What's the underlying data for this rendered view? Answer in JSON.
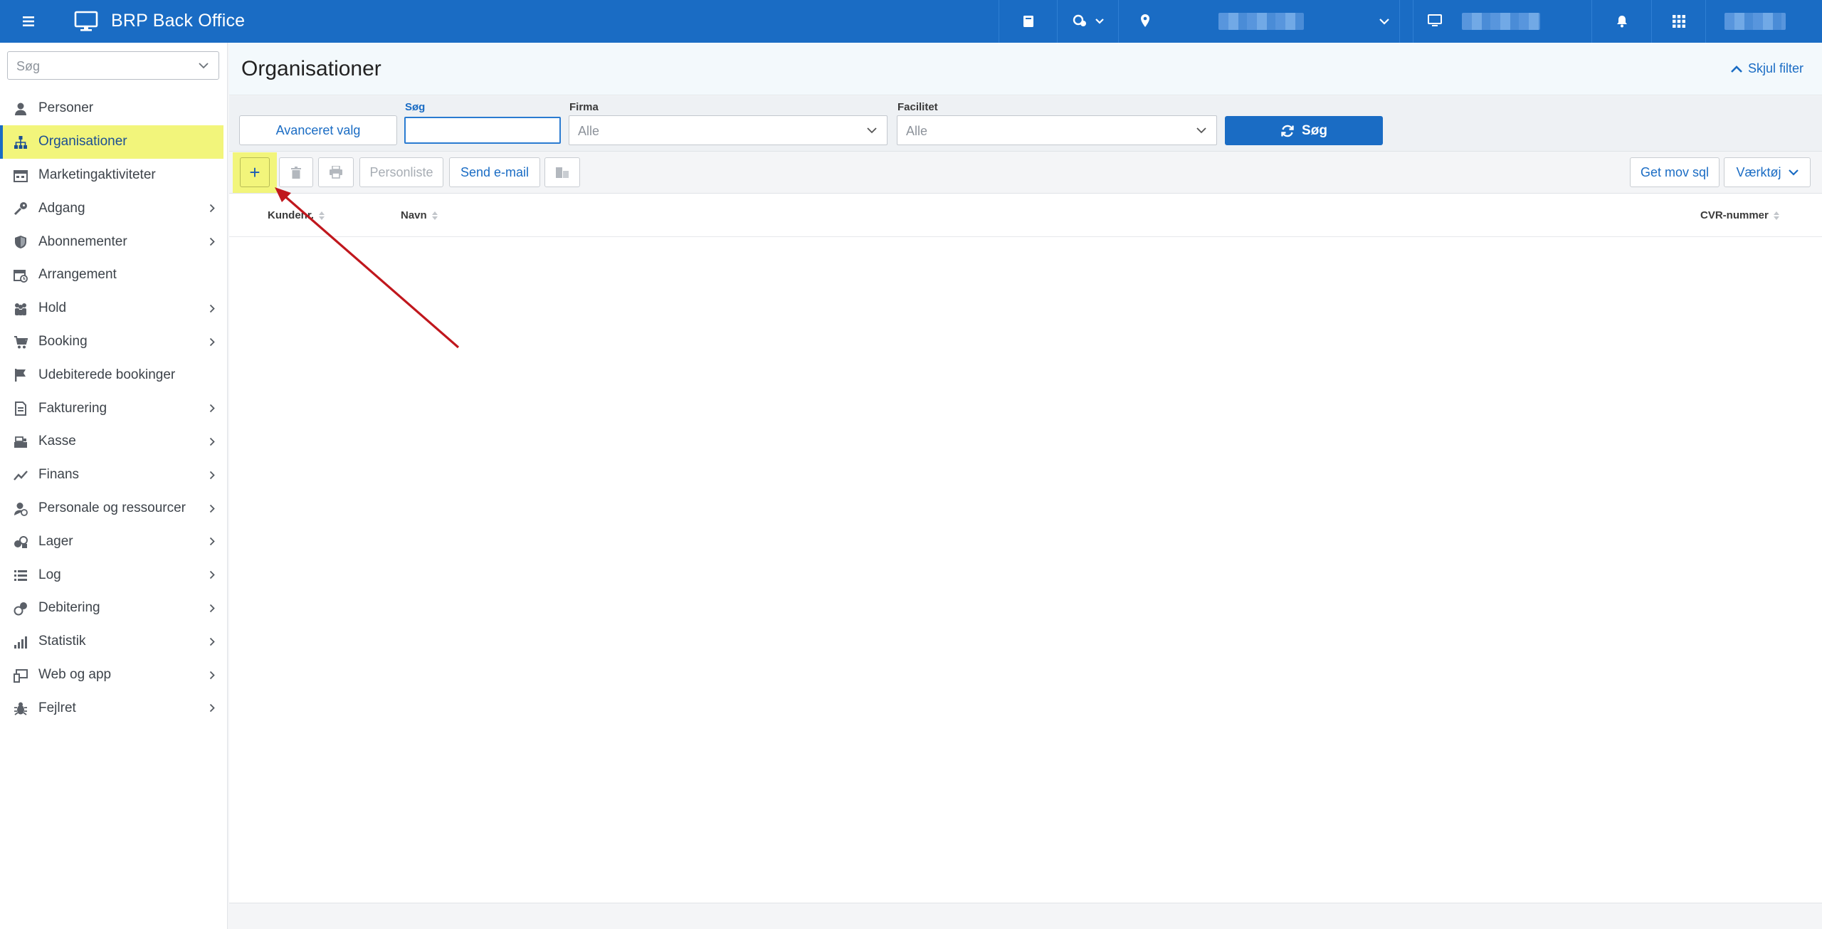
{
  "app": {
    "title": "BRP Back Office"
  },
  "topbar": {
    "icons": [
      "menu-icon",
      "monitor-icon",
      "book-icon",
      "user-location-icon",
      "location-pin-icon",
      "chevron-down-icon",
      "monitor-icon",
      "bell-icon",
      "apps-grid-icon"
    ]
  },
  "sidebar": {
    "search_placeholder": "Søg",
    "items": [
      {
        "label": "Personer",
        "icon": "person-icon",
        "arrow": false
      },
      {
        "label": "Organisationer",
        "icon": "org-chart-icon",
        "arrow": false,
        "active": true
      },
      {
        "label": "Marketingaktiviteter",
        "icon": "calendar-grid-icon",
        "arrow": false
      },
      {
        "label": "Adgang",
        "icon": "key-icon",
        "arrow": true
      },
      {
        "label": "Abonnementer",
        "icon": "shield-icon",
        "arrow": true
      },
      {
        "label": "Arrangement",
        "icon": "calendar-clock-icon",
        "arrow": false
      },
      {
        "label": "Hold",
        "icon": "group-icon",
        "arrow": true
      },
      {
        "label": "Booking",
        "icon": "cart-icon",
        "arrow": true
      },
      {
        "label": "Udebiterede bookinger",
        "icon": "flag-icon",
        "arrow": false
      },
      {
        "label": "Fakturering",
        "icon": "invoice-icon",
        "arrow": true
      },
      {
        "label": "Kasse",
        "icon": "cash-register-icon",
        "arrow": true
      },
      {
        "label": "Finans",
        "icon": "trend-line-icon",
        "arrow": true
      },
      {
        "label": "Personale og ressourcer",
        "icon": "staff-icon",
        "arrow": true
      },
      {
        "label": "Lager",
        "icon": "boxes-icon",
        "arrow": true
      },
      {
        "label": "Log",
        "icon": "list-icon",
        "arrow": true
      },
      {
        "label": "Debitering",
        "icon": "coins-icon",
        "arrow": true
      },
      {
        "label": "Statistik",
        "icon": "bar-chart-icon",
        "arrow": true
      },
      {
        "label": "Web og app",
        "icon": "devices-icon",
        "arrow": true
      },
      {
        "label": "Fejlret",
        "icon": "bug-icon",
        "arrow": true
      }
    ]
  },
  "page": {
    "title": "Organisationer",
    "hide_filter": "Skjul filter"
  },
  "filter": {
    "advanced_label": "Avanceret valg",
    "search_label": "Søg",
    "search_value": "",
    "firma_label": "Firma",
    "firma_value": "Alle",
    "facilitet_label": "Facilitet",
    "facilitet_value": "Alle",
    "search_button": "Søg"
  },
  "toolbar": {
    "add_label": "+",
    "person_list": "Personliste",
    "send_email": "Send e-mail",
    "get_sql": "Get mov sql",
    "tools": "Værktøj"
  },
  "table": {
    "columns": [
      "Kundenr.",
      "Navn",
      "CVR-nummer"
    ],
    "rows": []
  },
  "colors": {
    "brand": "#1a6cc4",
    "highlight": "#f2f57b",
    "annotation_arrow": "#c0171d"
  }
}
